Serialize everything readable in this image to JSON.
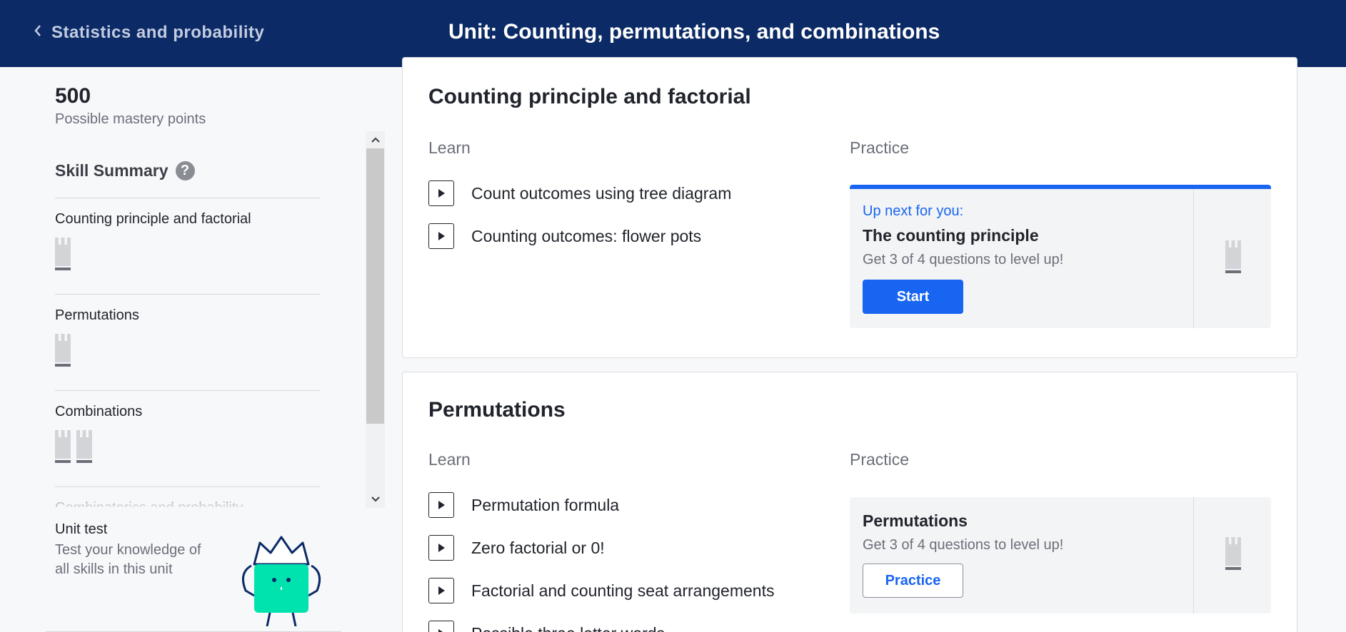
{
  "header": {
    "back_label": "Statistics and probability",
    "unit_title": "Unit: Counting, permutations, and combinations"
  },
  "sidebar": {
    "mastery_points": "500",
    "mastery_label": "Possible mastery points",
    "skill_summary_label": "Skill Summary",
    "help_glyph": "?",
    "skills": [
      {
        "name": "Counting principle and factorial",
        "crowns": 1
      },
      {
        "name": "Permutations",
        "crowns": 1
      },
      {
        "name": "Combinations",
        "crowns": 2
      },
      {
        "name": "Combinatorics and probability",
        "crowns": 0
      }
    ],
    "unit_test": {
      "title": "Unit test",
      "description": "Test your knowledge of all skills in this unit"
    }
  },
  "sections": [
    {
      "title": "Counting principle and factorial",
      "learn_label": "Learn",
      "practice_label": "Practice",
      "lessons": [
        "Count outcomes using tree diagram",
        "Counting outcomes: flower pots"
      ],
      "practice": {
        "up_next": "Up next for you:",
        "title": "The counting principle",
        "subtitle": "Get 3 of 4 questions to level up!",
        "button": "Start"
      }
    },
    {
      "title": "Permutations",
      "learn_label": "Learn",
      "practice_label": "Practice",
      "lessons": [
        "Permutation formula",
        "Zero factorial or 0!",
        "Factorial and counting seat arrangements",
        "Possible three letter words"
      ],
      "practice": {
        "title": "Permutations",
        "subtitle": "Get 3 of 4 questions to level up!",
        "button": "Practice"
      }
    }
  ],
  "colors": {
    "header_bg": "#0b2a66",
    "accent": "#1865f2",
    "mascot": "#00e3ae"
  }
}
